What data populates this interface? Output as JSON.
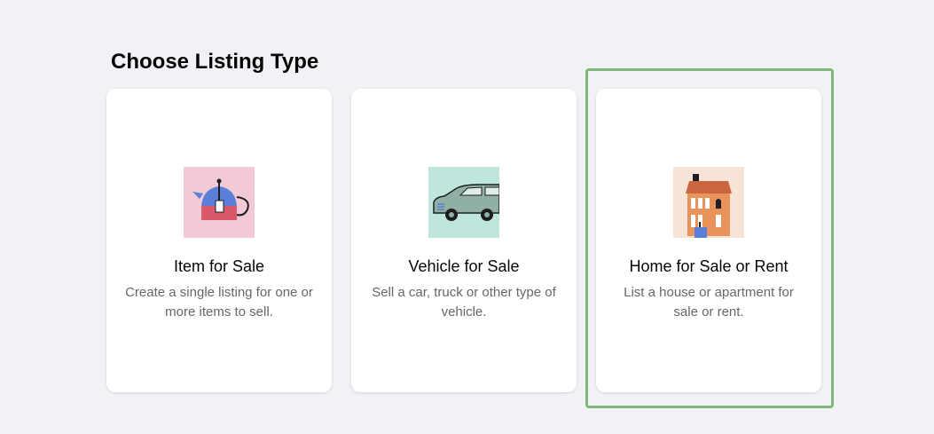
{
  "heading": "Choose Listing Type",
  "cards": [
    {
      "title": "Item for Sale",
      "description": "Create a single listing for one or more items to sell.",
      "icon": "teapot-icon"
    },
    {
      "title": "Vehicle for Sale",
      "description": "Sell a car, truck or other type of vehicle.",
      "icon": "car-icon"
    },
    {
      "title": "Home for Sale or Rent",
      "description": "List a house or apartment for sale or rent.",
      "icon": "house-icon",
      "selected": true
    }
  ],
  "colors": {
    "background": "#f0f2f5",
    "card": "#ffffff",
    "selection_outline": "#7fb776",
    "title": "#050505",
    "description": "#65676b"
  }
}
